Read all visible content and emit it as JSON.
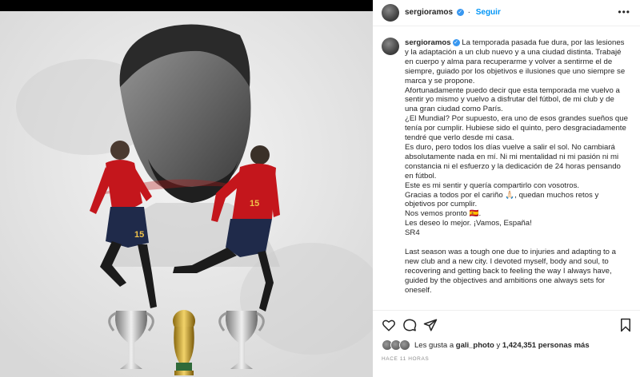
{
  "post": {
    "username": "sergioramos",
    "follow_label": "Seguir",
    "more_label": "•••",
    "verified_mark": "✓"
  },
  "caption": {
    "username": "sergioramos",
    "paragraphs": [
      "La temporada pasada fue dura, por las lesiones y la adaptación a un club nuevo y a una ciudad distinta. Trabajé en cuerpo y alma para recuperarme y volver a sentirme el de siempre, guiado por los objetivos e ilusiones que uno siempre se marca y se propone.",
      "Afortunadamente puedo decir que esta temporada me vuelvo a sentir yo mismo y vuelvo a disfrutar del fútbol, de mi club y de una gran ciudad como París.",
      "¿El Mundial? Por supuesto, era uno de esos grandes sueños que tenía por cumplir. Hubiese sido el quinto, pero desgraciadamente tendré que verlo desde mi casa.",
      "Es duro, pero todos los días vuelve a salir el sol. No cambiará absolutamente nada en mí. Ni mi mentalidad ni mi pasión ni mi constancia ni el esfuerzo y la dedicación de 24 horas pensando en fútbol.",
      "Este es mi sentir y quería compartirlo con vosotros.",
      "Gracias a todos por el cariño 🙏🏻, quedan muchos retos y objetivos por cumplir.",
      "Nos vemos pronto 🇪🇸.",
      "Les deseo lo mejor. ¡Vamos, España!",
      "SR4",
      "Last season was a tough one due to injuries and adapting to a new club and a new city. I devoted myself, body and soul, to recovering and getting back to feeling the way I always have, guided by the objectives and ambitions one always sets for oneself."
    ]
  },
  "actions": {
    "like": "heart-icon",
    "comment": "comment-icon",
    "share": "share-icon",
    "save": "bookmark-icon"
  },
  "likes": {
    "prefix": "Les gusta a",
    "user": "gali_photo",
    "middle": "y",
    "count": "1,424,351 personas más"
  },
  "timestamp": "HACE 11 HORAS",
  "colors": {
    "link": "#0095f6",
    "verified": "#3897f0",
    "jersey": "#c4161c",
    "gold": "#c9a227"
  }
}
